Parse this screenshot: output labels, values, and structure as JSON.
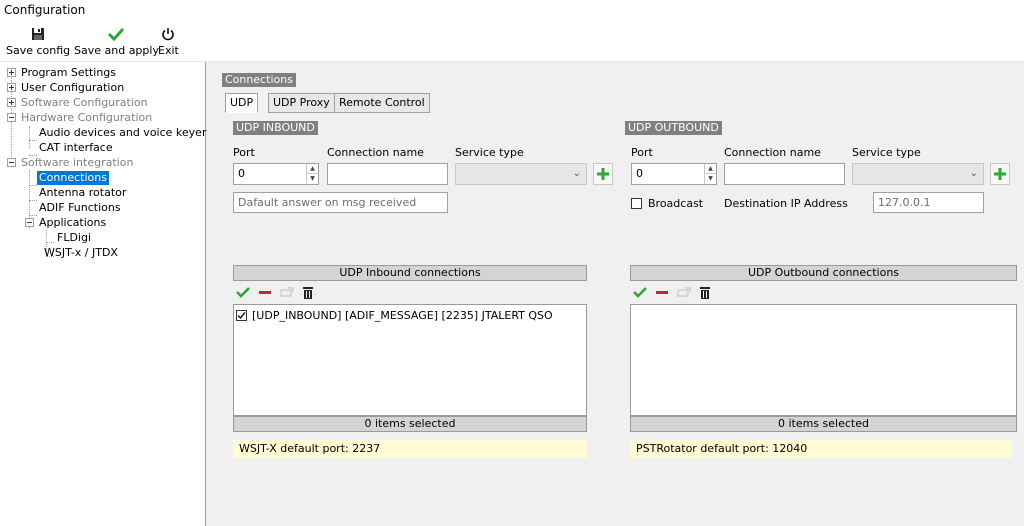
{
  "window": {
    "title": "Configuration"
  },
  "toolbar": {
    "save_config": "Save config",
    "save_and_apply": "Save and apply",
    "exit": "Exit"
  },
  "tree": {
    "program_settings": "Program Settings",
    "user_configuration": "User Configuration",
    "software_configuration": "Software Configuration",
    "hardware_configuration": "Hardware Configuration",
    "audio_devices": "Audio devices and voice keyer",
    "cat_interface": "CAT interface",
    "software_integration": "Software integration",
    "connections": "Connections",
    "antenna_rotator": "Antenna rotator",
    "adif_functions": "ADIF Functions",
    "applications": "Applications",
    "fldigi": "FLDigi",
    "wsjt": "WSJT-x / JTDX"
  },
  "main": {
    "group_title": "Connections",
    "tabs": [
      "UDP",
      "UDP Proxy",
      "Remote Control"
    ],
    "inbound": {
      "header": "UDP INBOUND",
      "port_label": "Port",
      "port_value": "0",
      "conn_name_label": "Connection name",
      "conn_name_value": "",
      "service_type_label": "Service type",
      "default_answer_placeholder": "Dafault answer on msg received",
      "list_header": "UDP Inbound connections",
      "items": [
        "[UDP_INBOUND] [ADIF_MESSAGE] [2235] JTALERT QSO"
      ],
      "footer": "0 items selected",
      "note": "WSJT-X default port: 2237"
    },
    "outbound": {
      "header": "UDP OUTBOUND",
      "port_label": "Port",
      "port_value": "0",
      "conn_name_label": "Connection name",
      "service_type_label": "Service type",
      "broadcast_label": "Broadcast",
      "dest_ip_label": "Destination IP Address",
      "dest_ip_value": "127.0.0.1",
      "list_header": "UDP Outbound connections",
      "footer": "0 items selected",
      "note": "PSTRotator default port: 12040"
    }
  },
  "colors": {
    "accent": "#0078d7",
    "check_green": "#2fa82f",
    "minus_red": "#cc2222",
    "note_bg": "#fffbd5"
  }
}
